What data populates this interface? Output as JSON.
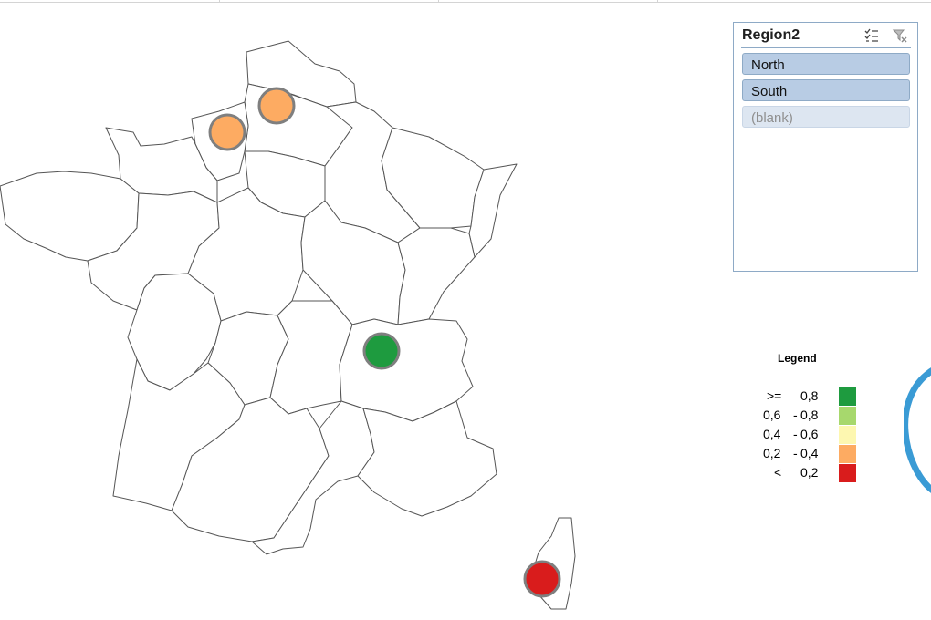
{
  "colors": {
    "ge_0_8": "#1e9b3f",
    "0_6_to_0_8": "#a7d86d",
    "0_4_to_0_6": "#fdf7b0",
    "0_2_to_0_4": "#fdab62",
    "lt_0_2": "#d91c1c",
    "marker_outline": "#7f7f7f",
    "slicer_border": "#8eaac6"
  },
  "slicer": {
    "title": "Region2",
    "icons": [
      "multi-select-icon",
      "clear-filter-icon"
    ],
    "items": [
      {
        "label": "North",
        "selected": true
      },
      {
        "label": "South",
        "selected": true
      },
      {
        "label": "(blank)",
        "selected": false
      }
    ]
  },
  "legend": {
    "title": "Legend",
    "rows": [
      {
        "op": ">=",
        "low": "",
        "high": "0,8",
        "color": "#1e9b3f"
      },
      {
        "op": "",
        "low": "0,6",
        "high": "0,8",
        "color": "#a7d86d"
      },
      {
        "op": "",
        "low": "0,4",
        "high": "0,6",
        "color": "#fdf7b0"
      },
      {
        "op": "",
        "low": "0,2",
        "high": "0,4",
        "color": "#fdab62"
      },
      {
        "op": "<",
        "low": "",
        "high": "0,2",
        "color": "#d91c1c"
      }
    ]
  },
  "markers": [
    {
      "region": "Haute-Normandie",
      "band": "0,2 - 0,4",
      "color": "#fdab62"
    },
    {
      "region": "Picardie",
      "band": "0,2 - 0,4",
      "color": "#fdab62"
    },
    {
      "region": "Rhône-Alpes",
      "band": ">= 0,8",
      "color": "#1e9b3f"
    },
    {
      "region": "Corse",
      "band": "< 0,2",
      "color": "#d91c1c"
    }
  ]
}
